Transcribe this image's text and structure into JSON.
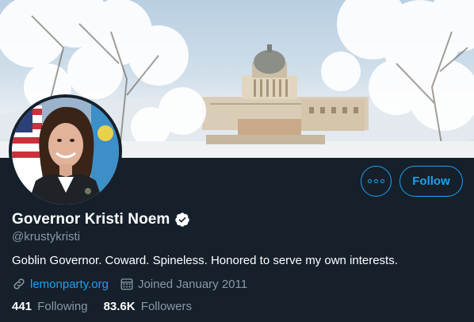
{
  "profile": {
    "display_name": "Governor Kristi Noem",
    "handle": "@krustykristi",
    "bio": "Goblin Governor. Coward. Spineless. Honored to serve my own interests.",
    "website": "lemonparty.org",
    "joined": "Joined January 2011",
    "verified": true
  },
  "stats": {
    "following_count": "441",
    "following_label": "Following",
    "followers_count": "83.6K",
    "followers_label": "Followers"
  },
  "actions": {
    "follow_label": "Follow",
    "more_icon": "more-options-icon"
  },
  "colors": {
    "background": "#15202b",
    "accent": "#1da1f2",
    "secondary_text": "#8899a6",
    "primary_text": "#ffffff"
  }
}
